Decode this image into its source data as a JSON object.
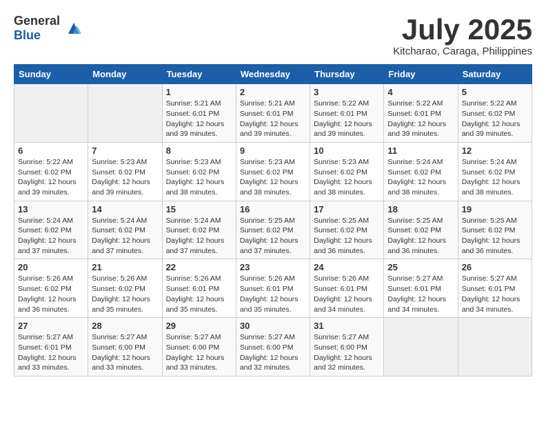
{
  "header": {
    "logo": {
      "general": "General",
      "blue": "Blue"
    },
    "title": "July 2025",
    "location": "Kitcharao, Caraga, Philippines"
  },
  "calendar": {
    "weekdays": [
      "Sunday",
      "Monday",
      "Tuesday",
      "Wednesday",
      "Thursday",
      "Friday",
      "Saturday"
    ],
    "weeks": [
      [
        {
          "day": "",
          "empty": true
        },
        {
          "day": "",
          "empty": true
        },
        {
          "day": "1",
          "sunrise": "Sunrise: 5:21 AM",
          "sunset": "Sunset: 6:01 PM",
          "daylight": "Daylight: 12 hours and 39 minutes."
        },
        {
          "day": "2",
          "sunrise": "Sunrise: 5:21 AM",
          "sunset": "Sunset: 6:01 PM",
          "daylight": "Daylight: 12 hours and 39 minutes."
        },
        {
          "day": "3",
          "sunrise": "Sunrise: 5:22 AM",
          "sunset": "Sunset: 6:01 PM",
          "daylight": "Daylight: 12 hours and 39 minutes."
        },
        {
          "day": "4",
          "sunrise": "Sunrise: 5:22 AM",
          "sunset": "Sunset: 6:01 PM",
          "daylight": "Daylight: 12 hours and 39 minutes."
        },
        {
          "day": "5",
          "sunrise": "Sunrise: 5:22 AM",
          "sunset": "Sunset: 6:02 PM",
          "daylight": "Daylight: 12 hours and 39 minutes."
        }
      ],
      [
        {
          "day": "6",
          "sunrise": "Sunrise: 5:22 AM",
          "sunset": "Sunset: 6:02 PM",
          "daylight": "Daylight: 12 hours and 39 minutes."
        },
        {
          "day": "7",
          "sunrise": "Sunrise: 5:23 AM",
          "sunset": "Sunset: 6:02 PM",
          "daylight": "Daylight: 12 hours and 39 minutes."
        },
        {
          "day": "8",
          "sunrise": "Sunrise: 5:23 AM",
          "sunset": "Sunset: 6:02 PM",
          "daylight": "Daylight: 12 hours and 38 minutes."
        },
        {
          "day": "9",
          "sunrise": "Sunrise: 5:23 AM",
          "sunset": "Sunset: 6:02 PM",
          "daylight": "Daylight: 12 hours and 38 minutes."
        },
        {
          "day": "10",
          "sunrise": "Sunrise: 5:23 AM",
          "sunset": "Sunset: 6:02 PM",
          "daylight": "Daylight: 12 hours and 38 minutes."
        },
        {
          "day": "11",
          "sunrise": "Sunrise: 5:24 AM",
          "sunset": "Sunset: 6:02 PM",
          "daylight": "Daylight: 12 hours and 38 minutes."
        },
        {
          "day": "12",
          "sunrise": "Sunrise: 5:24 AM",
          "sunset": "Sunset: 6:02 PM",
          "daylight": "Daylight: 12 hours and 38 minutes."
        }
      ],
      [
        {
          "day": "13",
          "sunrise": "Sunrise: 5:24 AM",
          "sunset": "Sunset: 6:02 PM",
          "daylight": "Daylight: 12 hours and 37 minutes."
        },
        {
          "day": "14",
          "sunrise": "Sunrise: 5:24 AM",
          "sunset": "Sunset: 6:02 PM",
          "daylight": "Daylight: 12 hours and 37 minutes."
        },
        {
          "day": "15",
          "sunrise": "Sunrise: 5:24 AM",
          "sunset": "Sunset: 6:02 PM",
          "daylight": "Daylight: 12 hours and 37 minutes."
        },
        {
          "day": "16",
          "sunrise": "Sunrise: 5:25 AM",
          "sunset": "Sunset: 6:02 PM",
          "daylight": "Daylight: 12 hours and 37 minutes."
        },
        {
          "day": "17",
          "sunrise": "Sunrise: 5:25 AM",
          "sunset": "Sunset: 6:02 PM",
          "daylight": "Daylight: 12 hours and 36 minutes."
        },
        {
          "day": "18",
          "sunrise": "Sunrise: 5:25 AM",
          "sunset": "Sunset: 6:02 PM",
          "daylight": "Daylight: 12 hours and 36 minutes."
        },
        {
          "day": "19",
          "sunrise": "Sunrise: 5:25 AM",
          "sunset": "Sunset: 6:02 PM",
          "daylight": "Daylight: 12 hours and 36 minutes."
        }
      ],
      [
        {
          "day": "20",
          "sunrise": "Sunrise: 5:26 AM",
          "sunset": "Sunset: 6:02 PM",
          "daylight": "Daylight: 12 hours and 36 minutes."
        },
        {
          "day": "21",
          "sunrise": "Sunrise: 5:26 AM",
          "sunset": "Sunset: 6:02 PM",
          "daylight": "Daylight: 12 hours and 35 minutes."
        },
        {
          "day": "22",
          "sunrise": "Sunrise: 5:26 AM",
          "sunset": "Sunset: 6:01 PM",
          "daylight": "Daylight: 12 hours and 35 minutes."
        },
        {
          "day": "23",
          "sunrise": "Sunrise: 5:26 AM",
          "sunset": "Sunset: 6:01 PM",
          "daylight": "Daylight: 12 hours and 35 minutes."
        },
        {
          "day": "24",
          "sunrise": "Sunrise: 5:26 AM",
          "sunset": "Sunset: 6:01 PM",
          "daylight": "Daylight: 12 hours and 34 minutes."
        },
        {
          "day": "25",
          "sunrise": "Sunrise: 5:27 AM",
          "sunset": "Sunset: 6:01 PM",
          "daylight": "Daylight: 12 hours and 34 minutes."
        },
        {
          "day": "26",
          "sunrise": "Sunrise: 5:27 AM",
          "sunset": "Sunset: 6:01 PM",
          "daylight": "Daylight: 12 hours and 34 minutes."
        }
      ],
      [
        {
          "day": "27",
          "sunrise": "Sunrise: 5:27 AM",
          "sunset": "Sunset: 6:01 PM",
          "daylight": "Daylight: 12 hours and 33 minutes."
        },
        {
          "day": "28",
          "sunrise": "Sunrise: 5:27 AM",
          "sunset": "Sunset: 6:00 PM",
          "daylight": "Daylight: 12 hours and 33 minutes."
        },
        {
          "day": "29",
          "sunrise": "Sunrise: 5:27 AM",
          "sunset": "Sunset: 6:00 PM",
          "daylight": "Daylight: 12 hours and 33 minutes."
        },
        {
          "day": "30",
          "sunrise": "Sunrise: 5:27 AM",
          "sunset": "Sunset: 6:00 PM",
          "daylight": "Daylight: 12 hours and 32 minutes."
        },
        {
          "day": "31",
          "sunrise": "Sunrise: 5:27 AM",
          "sunset": "Sunset: 6:00 PM",
          "daylight": "Daylight: 12 hours and 32 minutes."
        },
        {
          "day": "",
          "empty": true
        },
        {
          "day": "",
          "empty": true
        }
      ]
    ]
  }
}
